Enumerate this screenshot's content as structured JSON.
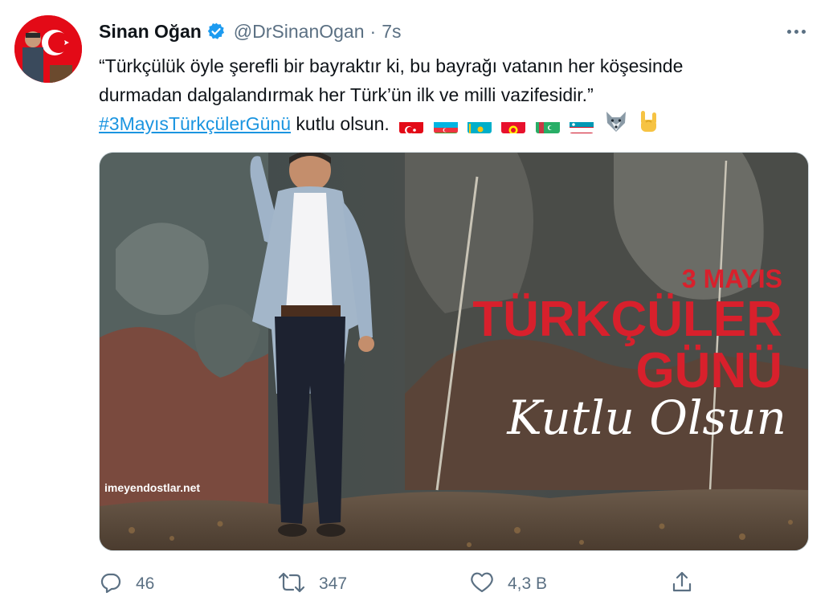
{
  "author": {
    "name": "Sinan Oğan",
    "handle": "@DrSinanOgan",
    "separator": "·",
    "time": "7s",
    "verified_icon": "verified-badge-icon"
  },
  "tweet": {
    "line1": "“Türkçülük öyle şerefli bir bayraktır ki, bu bayrağı vatanın her köşesinde",
    "line2": "durmadan dalgalandırmak her Türk’ün ilk ve milli vazifesidir.”",
    "hashtag": "#3MayısTürkçülerGünü",
    "after_hashtag": " kutlu olsun.",
    "emojis": [
      "flag-turkey",
      "flag-azerbaijan",
      "flag-kazakhstan",
      "flag-kyrgyzstan",
      "flag-turkmenistan",
      "flag-uzbekistan",
      "wolf-emoji",
      "rock-on-hand-emoji"
    ]
  },
  "media": {
    "banner_line1": "3 MAYIS",
    "banner_line2": "TÜRKÇÜLER",
    "banner_line3": "GÜNÜ",
    "script_text": "Kutlu Olsun",
    "watermark": "imeyendostlar.net"
  },
  "actions": {
    "reply_count": "46",
    "retweet_count": "347",
    "like_count": "4,3 B"
  },
  "colors": {
    "accent": "#1b95e0",
    "verified": "#1d9bf0",
    "muted": "#5b7083",
    "banner_red": "#d8202c"
  }
}
